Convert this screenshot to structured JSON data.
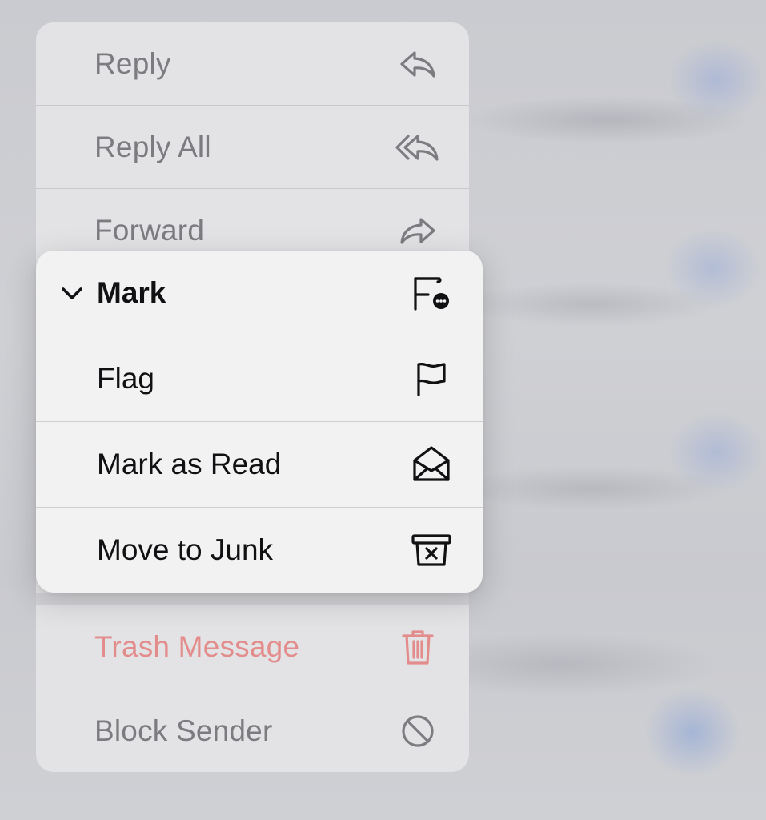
{
  "context_menu": {
    "items": [
      {
        "label": "Reply",
        "icon": "reply-icon"
      },
      {
        "label": "Reply All",
        "icon": "reply-all-icon"
      },
      {
        "label": "Forward",
        "icon": "forward-icon"
      },
      {
        "label": "Trash Message",
        "icon": "trash-icon",
        "color": "#e38c8c"
      },
      {
        "label": "Block Sender",
        "icon": "block-icon"
      }
    ]
  },
  "mark_submenu": {
    "title": "Mark",
    "title_icon": "flag-more-icon",
    "expanded_indicator": "chevron-down-icon",
    "items": [
      {
        "label": "Flag",
        "icon": "flag-icon"
      },
      {
        "label": "Mark as Read",
        "icon": "envelope-open-icon"
      },
      {
        "label": "Move to Junk",
        "icon": "junk-bin-icon"
      }
    ]
  },
  "colors": {
    "destructive": "#e38c8c",
    "menu_background": "#f2f2f3",
    "dimmed_menu_background": "#e3e3e6"
  }
}
